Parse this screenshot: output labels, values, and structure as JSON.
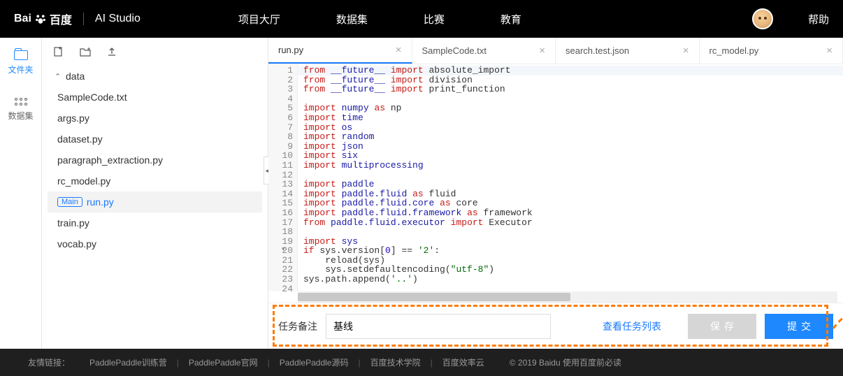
{
  "nav": {
    "brand_main": "百度",
    "brand_prefix": "Bai",
    "studio": "AI Studio",
    "links": [
      "项目大厅",
      "数据集",
      "比赛",
      "教育"
    ],
    "help": "帮助"
  },
  "rail": {
    "files": "文件夹",
    "dataset": "数据集"
  },
  "tree": {
    "folder": "data",
    "files": [
      "SampleCode.txt",
      "args.py",
      "dataset.py",
      "paragraph_extraction.py",
      "rc_model.py"
    ],
    "main_tag": "Main",
    "main_file": "run.py",
    "files2": [
      "train.py",
      "vocab.py"
    ]
  },
  "tabs": [
    "run.py",
    "SampleCode.txt",
    "search.test.json",
    "rc_model.py"
  ],
  "code": {
    "lines": [
      {
        "n": 1,
        "t": "from",
        "a": "__future__",
        "b": "import",
        "c": "absolute_import",
        "hl": true
      },
      {
        "n": 2,
        "t": "from",
        "a": "__future__",
        "b": "import",
        "c": "division"
      },
      {
        "n": 3,
        "t": "from",
        "a": "__future__",
        "b": "import",
        "c": "print_function"
      },
      {
        "n": 4,
        "blank": true
      },
      {
        "n": 5,
        "t": "import",
        "a": "numpy",
        "b": "as",
        "c": "np"
      },
      {
        "n": 6,
        "t": "import",
        "a": "time"
      },
      {
        "n": 7,
        "t": "import",
        "a": "os"
      },
      {
        "n": 8,
        "t": "import",
        "a": "random"
      },
      {
        "n": 9,
        "t": "import",
        "a": "json"
      },
      {
        "n": 10,
        "t": "import",
        "a": "six"
      },
      {
        "n": 11,
        "t": "import",
        "a": "multiprocessing"
      },
      {
        "n": 12,
        "blank": true
      },
      {
        "n": 13,
        "t": "import",
        "a": "paddle"
      },
      {
        "n": 14,
        "t": "import",
        "a": "paddle.fluid",
        "b": "as",
        "c": "fluid"
      },
      {
        "n": 15,
        "t": "import",
        "a": "paddle.fluid.core",
        "b": "as",
        "c": "core"
      },
      {
        "n": 16,
        "t": "import",
        "a": "paddle.fluid.framework",
        "b": "as",
        "c": "framework"
      },
      {
        "n": 17,
        "t": "from",
        "a": "paddle.fluid.executor",
        "b": "import",
        "c": "Executor"
      },
      {
        "n": 18,
        "blank": true
      },
      {
        "n": 19,
        "t": "import",
        "a": "sys"
      },
      {
        "n": 20,
        "raw": "if sys.version[0] == '2':",
        "kind": "if"
      },
      {
        "n": 21,
        "raw": "    reload(sys)"
      },
      {
        "n": 22,
        "raw": "    sys.setdefaultencoding(\"utf-8\")",
        "kind": "str"
      },
      {
        "n": 23,
        "raw": "sys.path.append('..')",
        "kind": "str"
      },
      {
        "n": 24,
        "blank": true
      }
    ]
  },
  "action": {
    "note_label": "任务备注",
    "note_value": "基线",
    "view_tasks": "查看任务列表",
    "save": "保存",
    "submit": "提交"
  },
  "footer": {
    "label": "友情链接：",
    "links": [
      "PaddlePaddle训练营",
      "PaddlePaddle官网",
      "PaddlePaddle源码",
      "百度技术学院",
      "百度效率云"
    ],
    "copyright": "© 2019 Baidu 使用百度前必读"
  }
}
